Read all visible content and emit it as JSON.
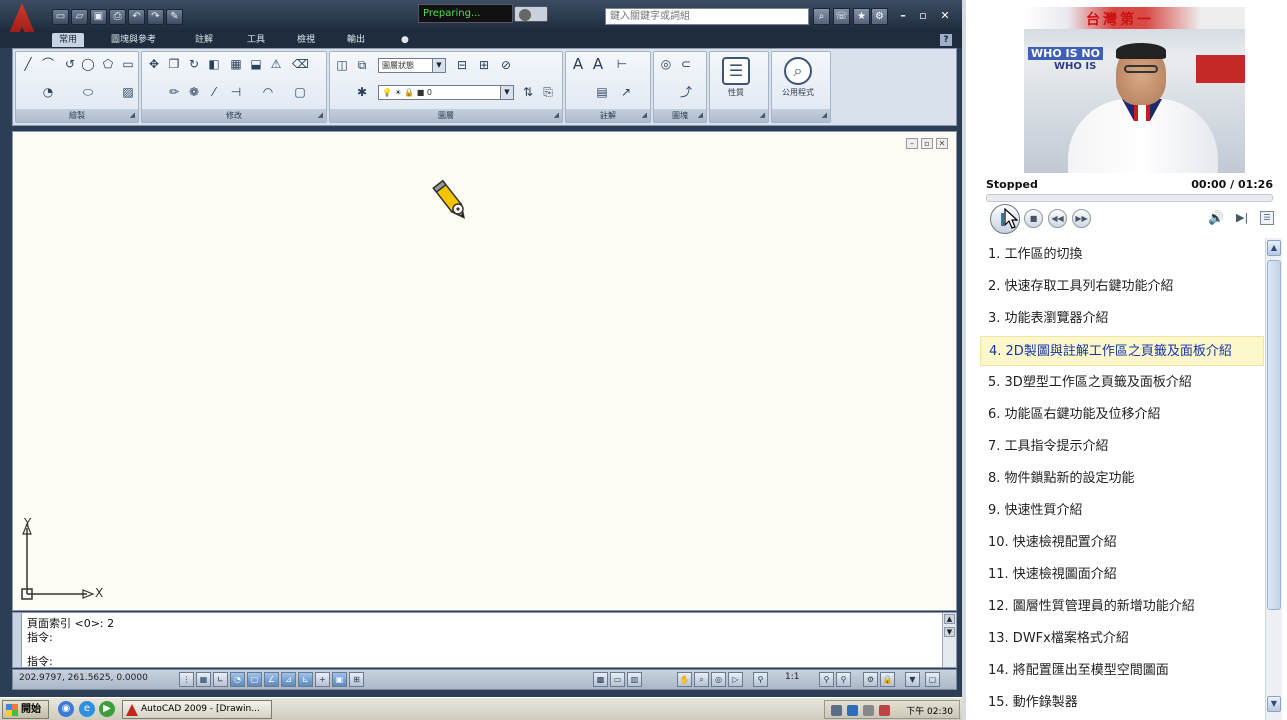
{
  "acad": {
    "progress_text": "Preparing...",
    "search_placeholder": "鍵入關鍵字或詞組",
    "ribbon_tabs": [
      "常用",
      "圖塊與參考",
      "註解",
      "工具",
      "檢視",
      "輸出"
    ],
    "panels": [
      "繪製",
      "修改",
      "圖層",
      "註解",
      "圖塊",
      "性質",
      "公用程式"
    ],
    "layer_state": "圖層狀態",
    "layer_current": "0",
    "command_lines": [
      "頁面索引 <0>: 2",
      "指令:",
      "指令:"
    ],
    "coords": "202.9797, 261.5625, 0.0000",
    "anno_scale": "1:1",
    "ucs_x": "X",
    "ucs_y": "Y"
  },
  "taskbar": {
    "start_label": "開始",
    "app_button": "AutoCAD 2009 - [Drawin...",
    "clock": "下午 02:30"
  },
  "player": {
    "video_banner_text": "台灣第一",
    "video_who1": "WHO IS NO",
    "video_who2": "WHO IS",
    "status": "Stopped",
    "time": "00:00 / 01:26",
    "playlist": [
      "1. 工作區的切換",
      "2. 快速存取工具列右鍵功能介紹",
      "3. 功能表瀏覽器介紹",
      "4. 2D製圖與註解工作區之頁籤及面板介紹",
      "5. 3D塑型工作區之頁籤及面板介紹",
      "6. 功能區右鍵功能及位移介紹",
      "7. 工具指令提示介紹",
      "8. 物件鎖點新的設定功能",
      "9. 快速性質介紹",
      "10. 快速檢視配置介紹",
      "11. 快速檢視圖面介紹",
      "12. 圖層性質管理員的新增功能介紹",
      "13. DWFx檔案格式介紹",
      "14. 將配置匯出至模型空間圖面",
      "15. 動作錄製器"
    ],
    "active_index": 3
  },
  "colors": {
    "canvas_bg": "#fdfcf5",
    "active_item_bg": "#fdf8cc",
    "active_item_text": "#1536a6"
  }
}
